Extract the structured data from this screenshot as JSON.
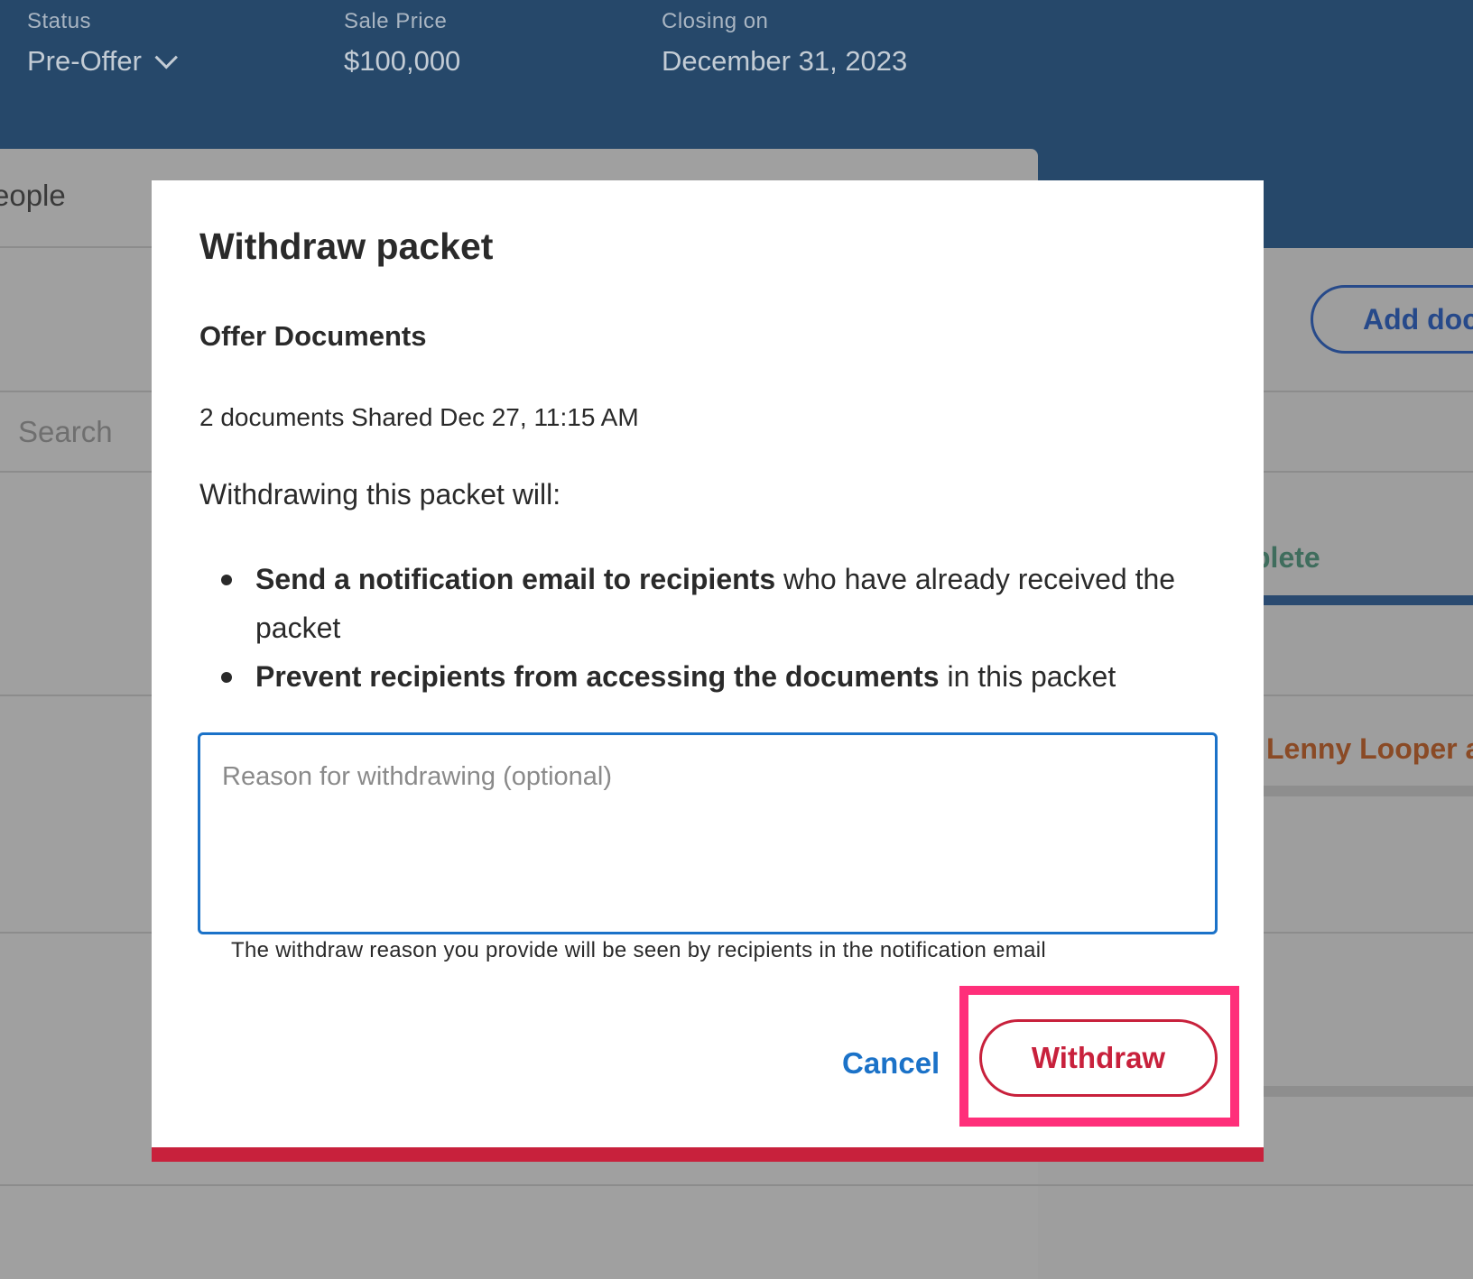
{
  "header": {
    "status_label": "Status",
    "status_value": "Pre-Offer",
    "price_label": "Sale Price",
    "price_value": "$100,000",
    "closing_label": "Closing on",
    "closing_value": "December 31, 2023"
  },
  "background": {
    "people_tab": "eople",
    "search_placeholder": "Search",
    "add_doc_button": "Add doc",
    "complete_tab": "plete",
    "person_name": "Lenny Looper a"
  },
  "modal": {
    "title": "Withdraw packet",
    "packet_name": "Offer Documents",
    "packet_meta": "2 documents Shared Dec 27, 11:15 AM",
    "intro": "Withdrawing this packet will:",
    "effects": [
      {
        "bold": "Send a notification email to recipients",
        "rest": " who have already received the packet"
      },
      {
        "bold": "Prevent recipients from accessing the documents",
        "rest": " in this packet"
      }
    ],
    "reason_placeholder": "Reason for withdrawing (optional)",
    "reason_value": "",
    "hint": "The withdraw reason you provide will be seen by recipients in the notification email",
    "cancel_label": "Cancel",
    "withdraw_label": "Withdraw"
  },
  "colors": {
    "header_bg": "#26486a",
    "primary_blue": "#1b72c8",
    "danger_red": "#c8213c",
    "highlight_pink": "#ff2f7a"
  }
}
